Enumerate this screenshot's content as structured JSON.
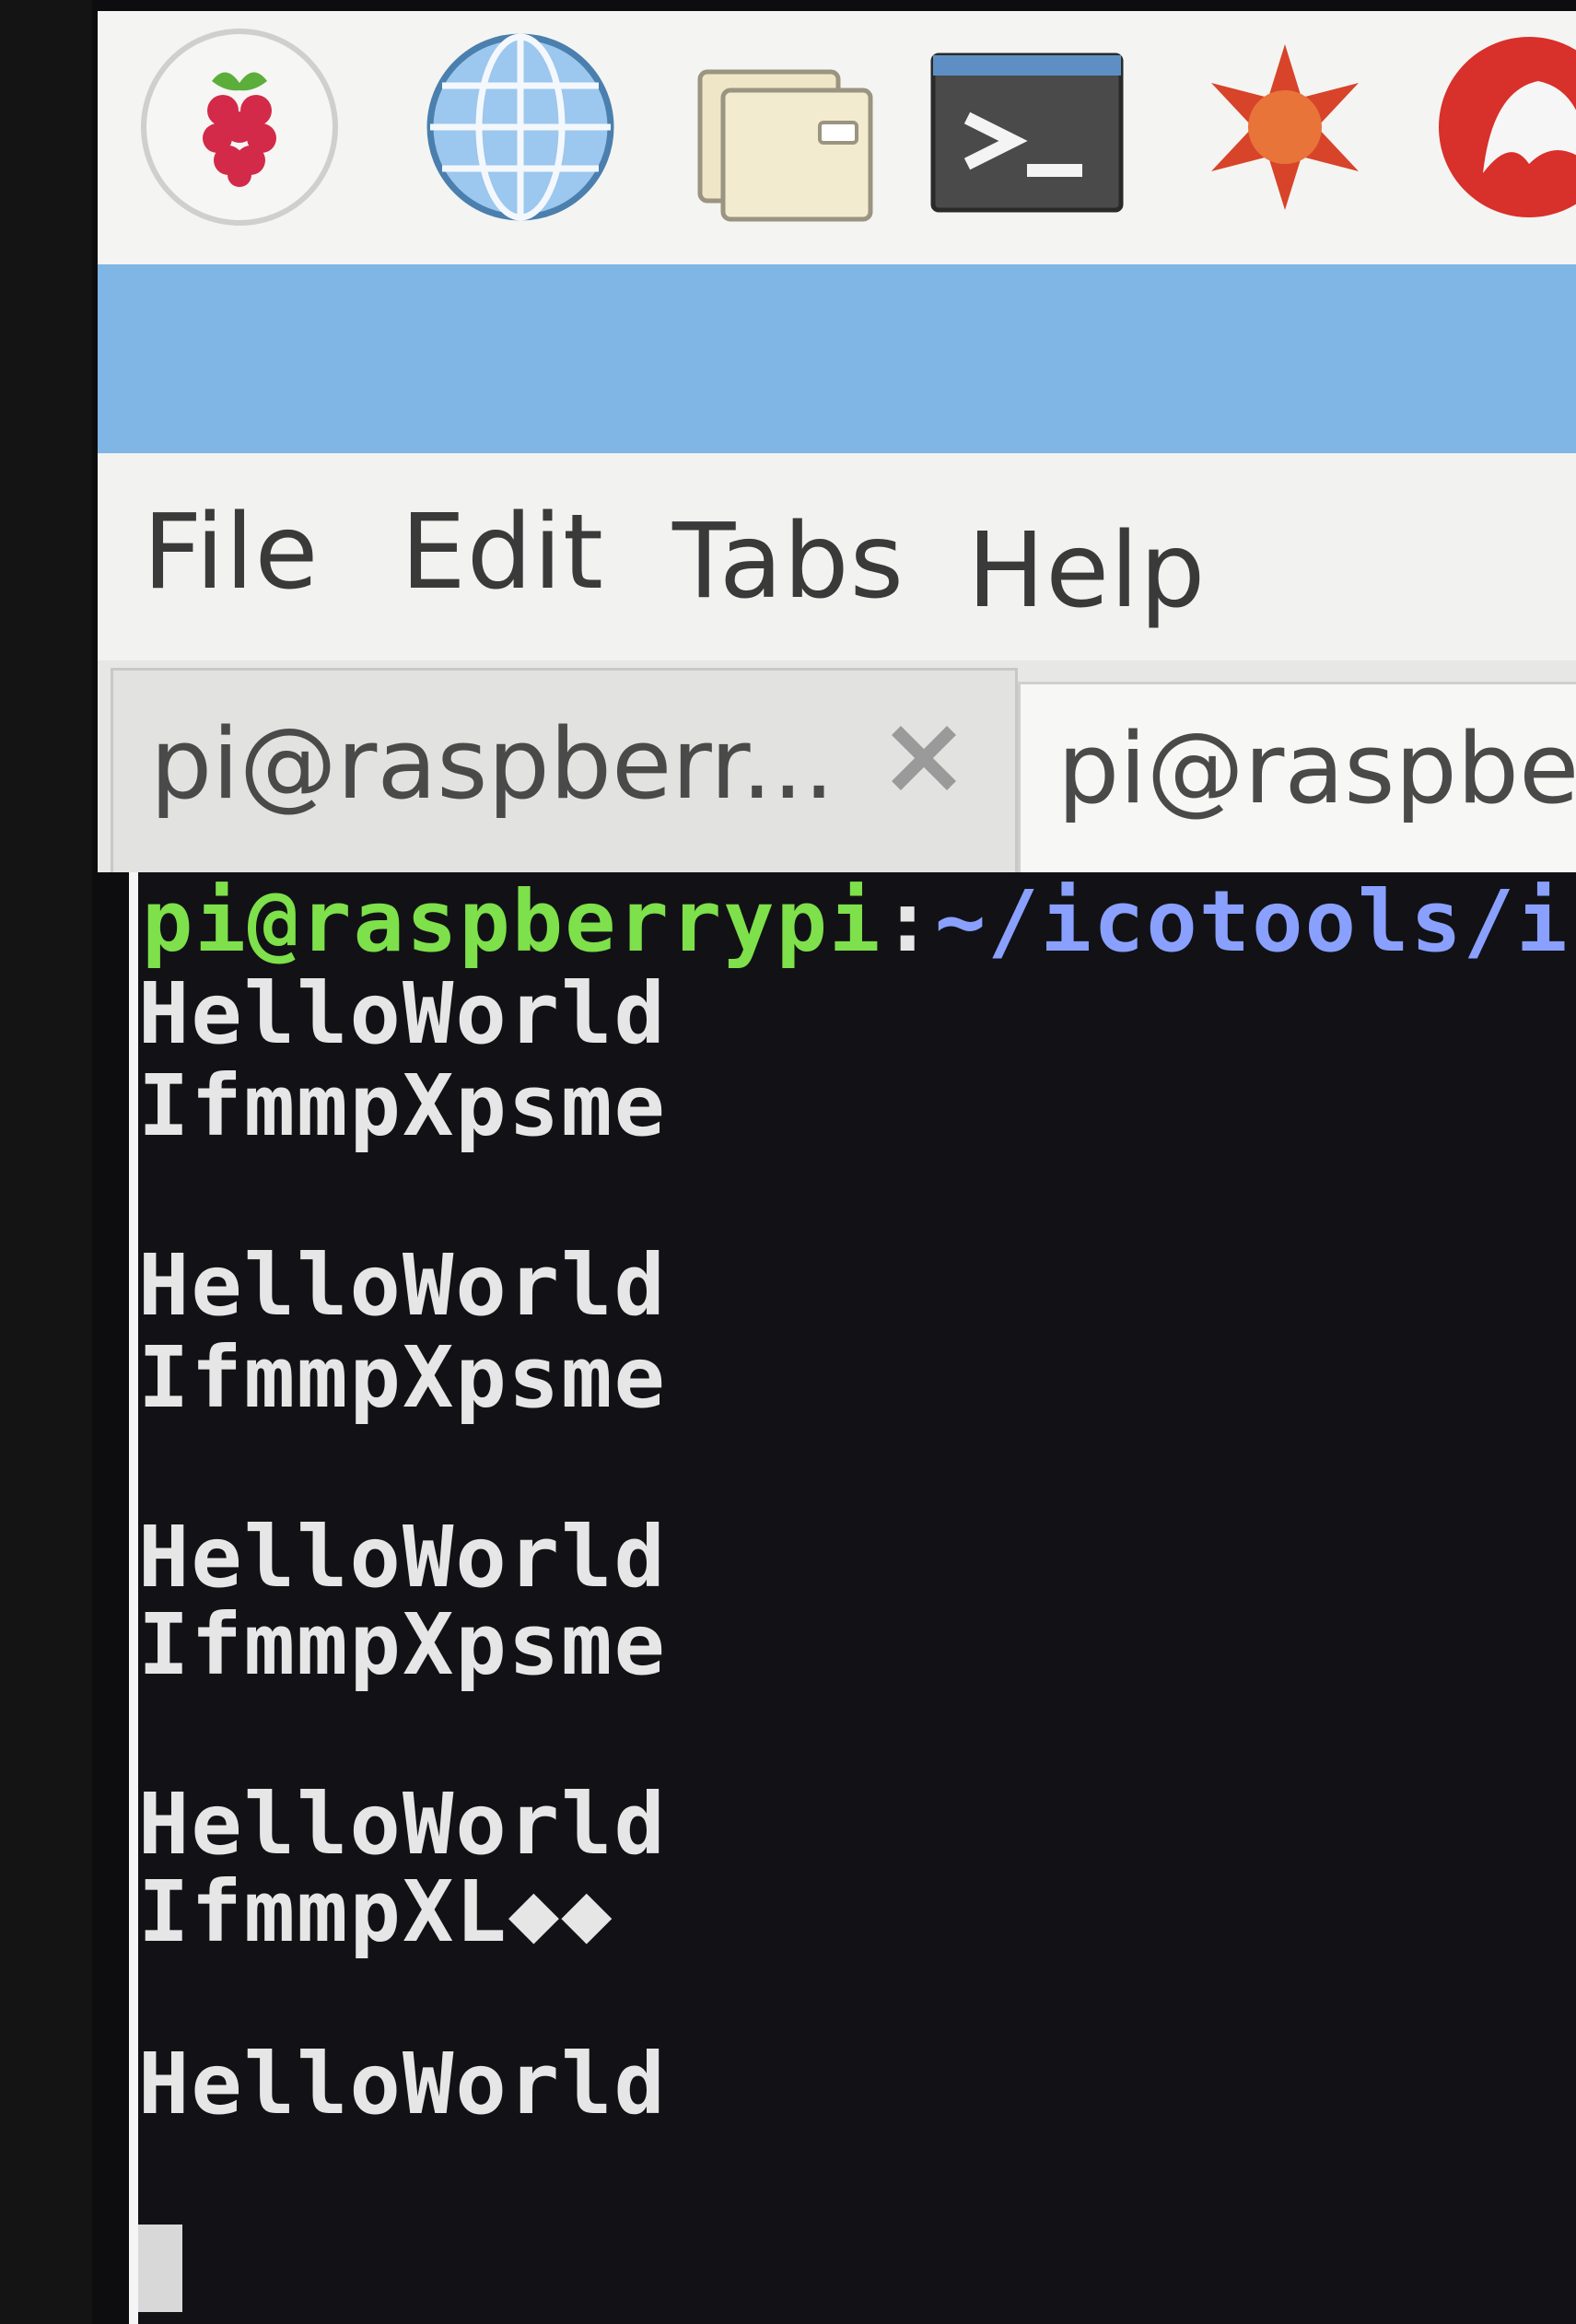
{
  "menubar": {
    "items": [
      "File",
      "Edit",
      "Tabs",
      "Help"
    ]
  },
  "tabs": [
    {
      "label": "pi@raspberr...",
      "active": false
    },
    {
      "label": "pi@raspberr",
      "active": true
    }
  ],
  "terminal": {
    "prompt_user": "pi@raspberrypi",
    "prompt_colon": ":",
    "prompt_path": "~/icotools/ico",
    "lines": [
      "HelloWorld",
      "IfmmpXpsme",
      "",
      "HelloWorld",
      "IfmmpXpsme",
      "",
      "HelloWorld",
      "IfmmpXpsme",
      "",
      "HelloWorld",
      "IfmmpXL◆◆",
      "",
      "HelloWorld"
    ],
    "colors": {
      "background": "#121216",
      "prompt_user": "#7ee04a",
      "prompt_path": "#8aa0ff",
      "text": "#e6e6e6"
    }
  },
  "panel": {
    "launchers": [
      "raspberry-menu-icon",
      "web-browser-icon",
      "file-manager-icon",
      "terminal-icon",
      "mathematica-icon",
      "wolfram-icon"
    ]
  },
  "colors": {
    "titlebar": "#7fb6e6",
    "panel": "#f4f4f2"
  }
}
